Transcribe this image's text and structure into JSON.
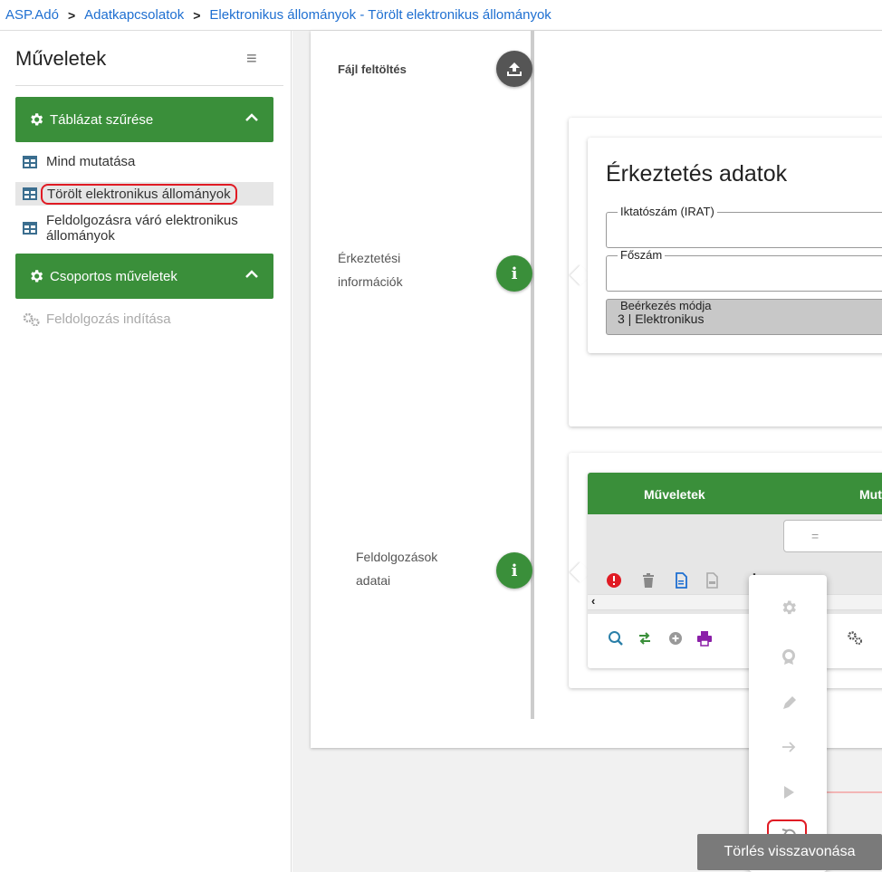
{
  "breadcrumb": {
    "items": [
      "ASP.Adó",
      "Adatkapcsolatok",
      "Elektronikus állományok - Törölt elektronikus állományok"
    ],
    "separator": ">"
  },
  "sidebar": {
    "title": "Műveletek",
    "group1": {
      "label": "Táblázat szűrése"
    },
    "items": [
      {
        "label": "Mind mutatása"
      },
      {
        "label": "Törölt elektronikus állományok"
      },
      {
        "label": "Feldolgozásra váró elektronikus állományok"
      }
    ],
    "group2": {
      "label": "Csoportos műveletek"
    },
    "disabled_item": {
      "label": "Feldolgozás indítása"
    }
  },
  "steps": {
    "upload_label": "Fájl feltöltés",
    "info_label_1": "Érkeztetési",
    "info_label_2": "információk",
    "proc_label_1": "Feldolgozások",
    "proc_label_2": "adatai"
  },
  "erkeztetes": {
    "title": "Érkeztetés adatok",
    "field1_label": "Iktatószám (IRAT)",
    "field1_value": "",
    "field2_label": "Főszám",
    "field2_value": "",
    "field3_label": "Beérkezés módja",
    "field3_value": "3 | Elektronikus"
  },
  "table": {
    "col1": "Műveletek",
    "col2_partial": "Mut",
    "filter_value": "="
  },
  "tooltip": {
    "text": "Törlés visszavonása"
  },
  "colors": {
    "accent": "#3a8f3a",
    "link": "#1e6fd1",
    "highlight": "#e01b24"
  }
}
